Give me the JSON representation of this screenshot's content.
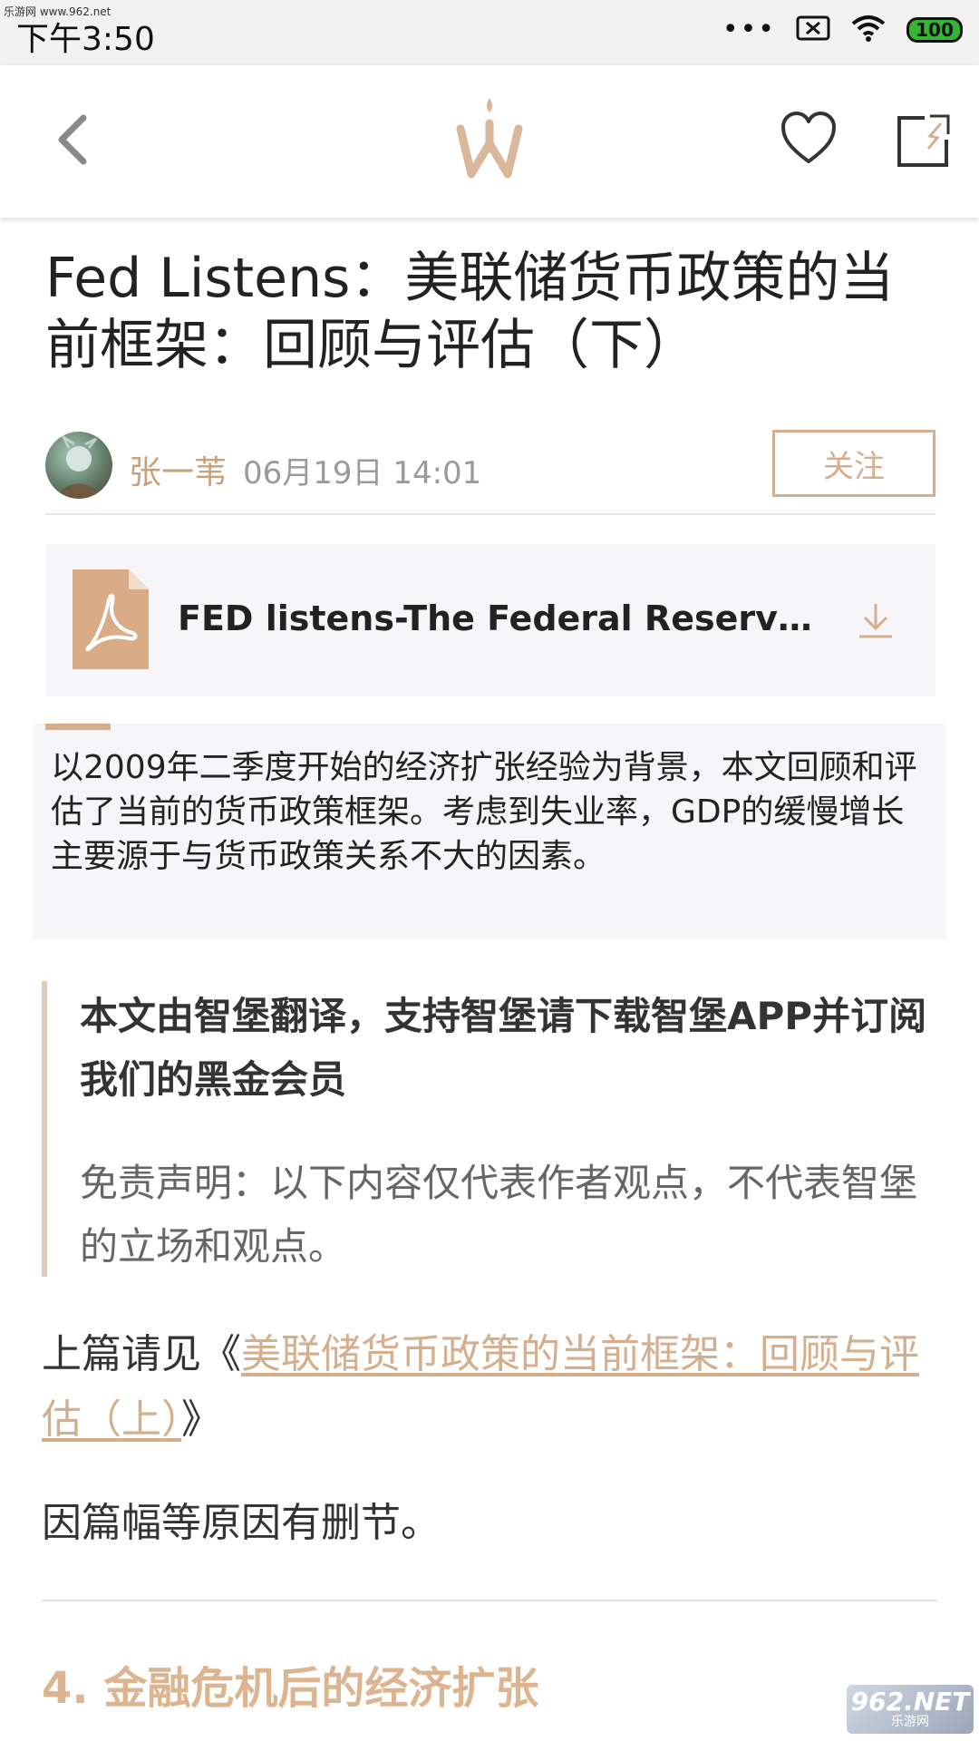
{
  "status_bar": {
    "watermark_text": "乐游网 www.962.net",
    "time": "下午3:50",
    "dots": "•••",
    "battery": "100"
  },
  "header": {
    "back_icon": "chevron-left-icon",
    "logo_icon": "w-logo-icon",
    "favorite_icon": "heart-icon",
    "share_icon": "share-icon"
  },
  "article": {
    "title": "Fed Listens：美联储货币政策的当前框架：回顾与评估（下）",
    "author": "张一苇",
    "date": "06月19日 14:01",
    "follow_label": "关注",
    "attachment": {
      "name": "FED listens-The Federal Reserve’s...",
      "icon": "pdf-icon",
      "download_icon": "download-icon"
    },
    "summary": "以2009年二季度开始的经济扩张经验为背景，本文回顾和评估了当前的货币政策框架。考虑到失业率，GDP的缓慢增长主要源于与货币政策关系不大的因素。",
    "quote_strong": "本文由智堡翻译，支持智堡请下载智堡APP并订阅我们的黑金会员",
    "quote_note": "免责声明：以下内容仅代表作者观点，不代表智堡的立场和观点。",
    "prev_prefix": "上篇请见《",
    "prev_link": "美联储货币政策的当前框架：回顾与评估（上）",
    "prev_suffix": "》",
    "cut_note": "因篇幅等原因有删节。",
    "section_title": "4. 金融危机后的经济扩张"
  },
  "watermark": {
    "big": "962.NET",
    "small": "乐游网"
  },
  "colors": {
    "accent": "#d4ae8d",
    "battery_green": "#35b535"
  }
}
